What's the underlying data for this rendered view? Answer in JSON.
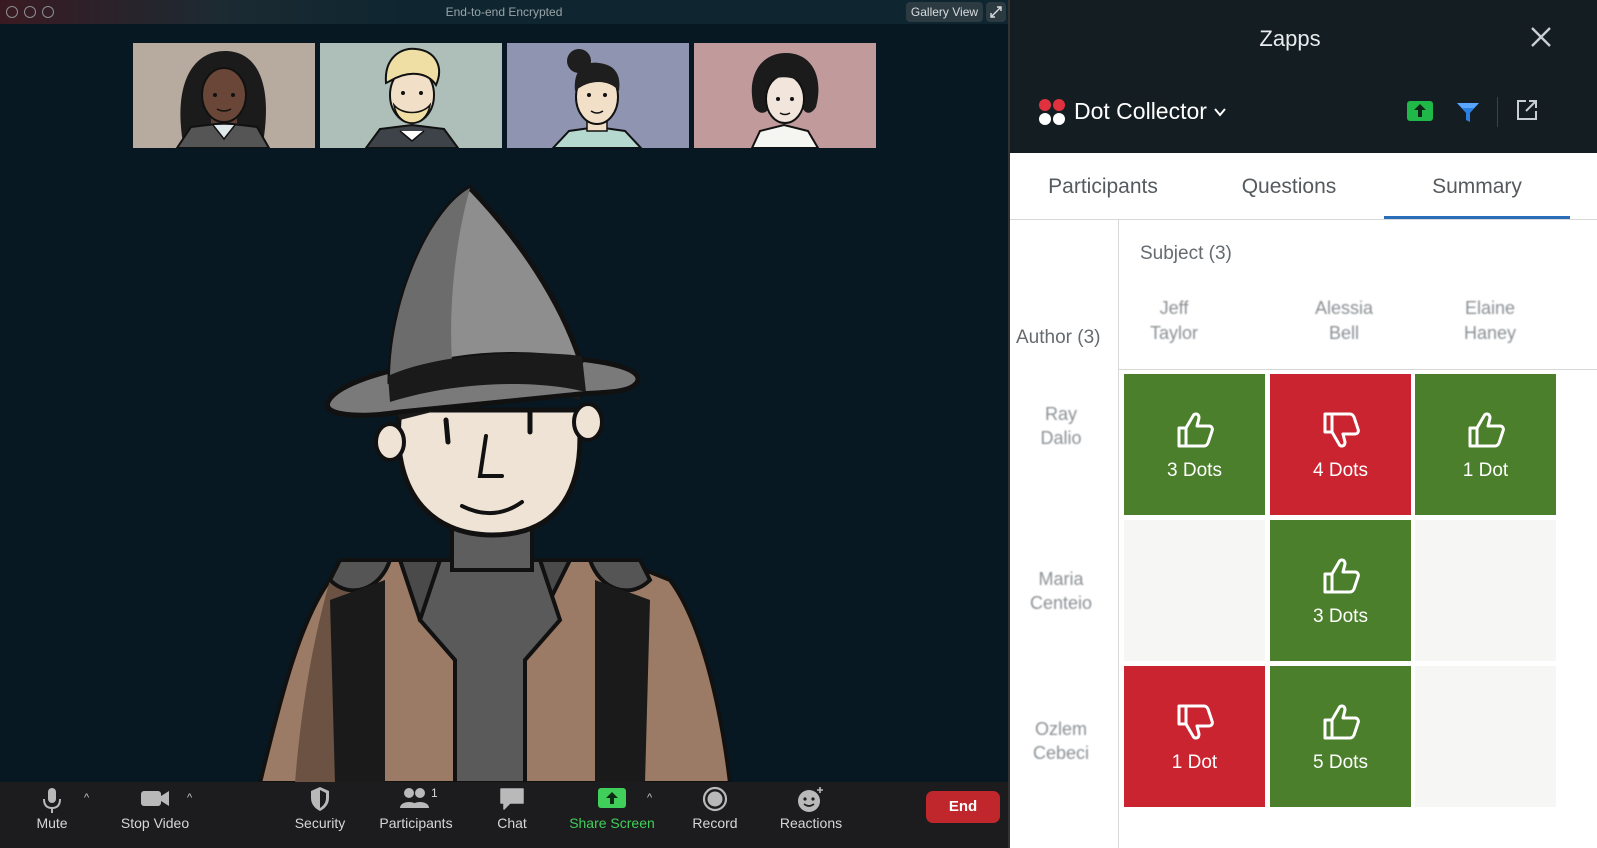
{
  "meeting": {
    "window_title": "End-to-end Encrypted",
    "gallery_view_label": "Gallery View"
  },
  "toolbar": {
    "mute": "Mute",
    "stop_video": "Stop Video",
    "security": "Security",
    "participants": "Participants",
    "participants_count": "1",
    "chat": "Chat",
    "share_screen": "Share Screen",
    "record": "Record",
    "reactions": "Reactions",
    "end": "End"
  },
  "zapps": {
    "title": "Zapps",
    "app_name": "Dot Collector",
    "tabs": [
      {
        "label": "Participants"
      },
      {
        "label": "Questions"
      },
      {
        "label": "Summary"
      }
    ],
    "active_tab": "Summary",
    "summary": {
      "subject_label": "Subject (3)",
      "author_label": "Author (3)",
      "subjects": [
        {
          "line1": "Jeff",
          "line2": "Taylor"
        },
        {
          "line1": "Alessia",
          "line2": "Bell"
        },
        {
          "line1": "Elaine",
          "line2": "Haney"
        }
      ],
      "authors": [
        {
          "line1": "Ray",
          "line2": "Dalio"
        },
        {
          "line1": "Maria",
          "line2": "Centeio"
        },
        {
          "line1": "Ozlem",
          "line2": "Cebeci"
        }
      ],
      "cells": [
        [
          {
            "type": "up",
            "label": "3 Dots"
          },
          {
            "type": "down",
            "label": "4 Dots"
          },
          {
            "type": "up",
            "label": "1 Dot"
          }
        ],
        [
          {
            "type": "empty",
            "label": ""
          },
          {
            "type": "up",
            "label": "3 Dots"
          },
          {
            "type": "empty",
            "label": ""
          }
        ],
        [
          {
            "type": "down",
            "label": "1 Dot"
          },
          {
            "type": "up",
            "label": "5 Dots"
          },
          {
            "type": "empty",
            "label": ""
          }
        ]
      ]
    }
  },
  "colors": {
    "up": "#4b7f2b",
    "down": "#c9242f",
    "end_button": "#c0272d",
    "share_screen": "#3fcf5a",
    "tab_underline": "#2a6db8"
  }
}
